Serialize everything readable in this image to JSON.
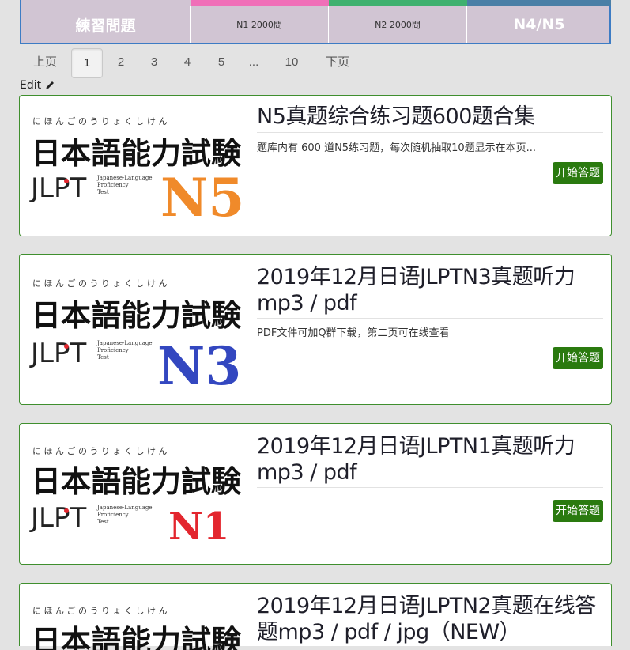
{
  "categories": [
    {
      "label": "練習問題",
      "color": "#d1c5d3",
      "style": "big"
    },
    {
      "label": "N1 2000問",
      "color": "#f06fb8",
      "style": "small"
    },
    {
      "label": "N2 2000問",
      "color": "#3fb16f",
      "style": "small"
    },
    {
      "label": "N4/N5",
      "color": "#4a7fa6",
      "style": "big"
    }
  ],
  "pagination": {
    "prev": "上页",
    "pages": [
      "1",
      "2",
      "3",
      "4",
      "5",
      "...",
      "10"
    ],
    "active": "1",
    "next": "下页"
  },
  "edit_label": "Edit",
  "thumbnail_text": {
    "kana": "に ほ ん ご の う り ょ く し け ん",
    "kanji": "日本語能力試験",
    "jlpt": "JLPT",
    "sub1": "Japanese-Language",
    "sub2": "Proficiency",
    "sub3": "Test"
  },
  "cards": [
    {
      "title": "N5真题综合练习题600题合集",
      "description": "题库内有 600 道N5练习题，每次随机抽取10题显示在本页...",
      "button": "开始答题",
      "level": "N5",
      "level_color": "#f08a2a",
      "icon": "jlpt-n5-thumbnail"
    },
    {
      "title": "2019年12月日语JLPTN3真题听力 mp3 / pdf",
      "description": "PDF文件可加Q群下载，第二页可在线查看",
      "button": "开始答题",
      "level": "N3",
      "level_color": "#3347c0",
      "icon": "jlpt-n3-thumbnail"
    },
    {
      "title": "2019年12月日语JLPTN1真题听力 mp3 / pdf",
      "description": "",
      "button": "开始答题",
      "level": "N1",
      "level_color": "#e3262e",
      "icon": "jlpt-n1-thumbnail"
    },
    {
      "title": "2019年12月日语JLPTN2真题在线答题mp3 / pdf / jpg（NEW）",
      "description": "",
      "button": "",
      "level": "N2",
      "level_color": "#2a7a0f",
      "icon": "jlpt-n2-thumbnail"
    }
  ]
}
